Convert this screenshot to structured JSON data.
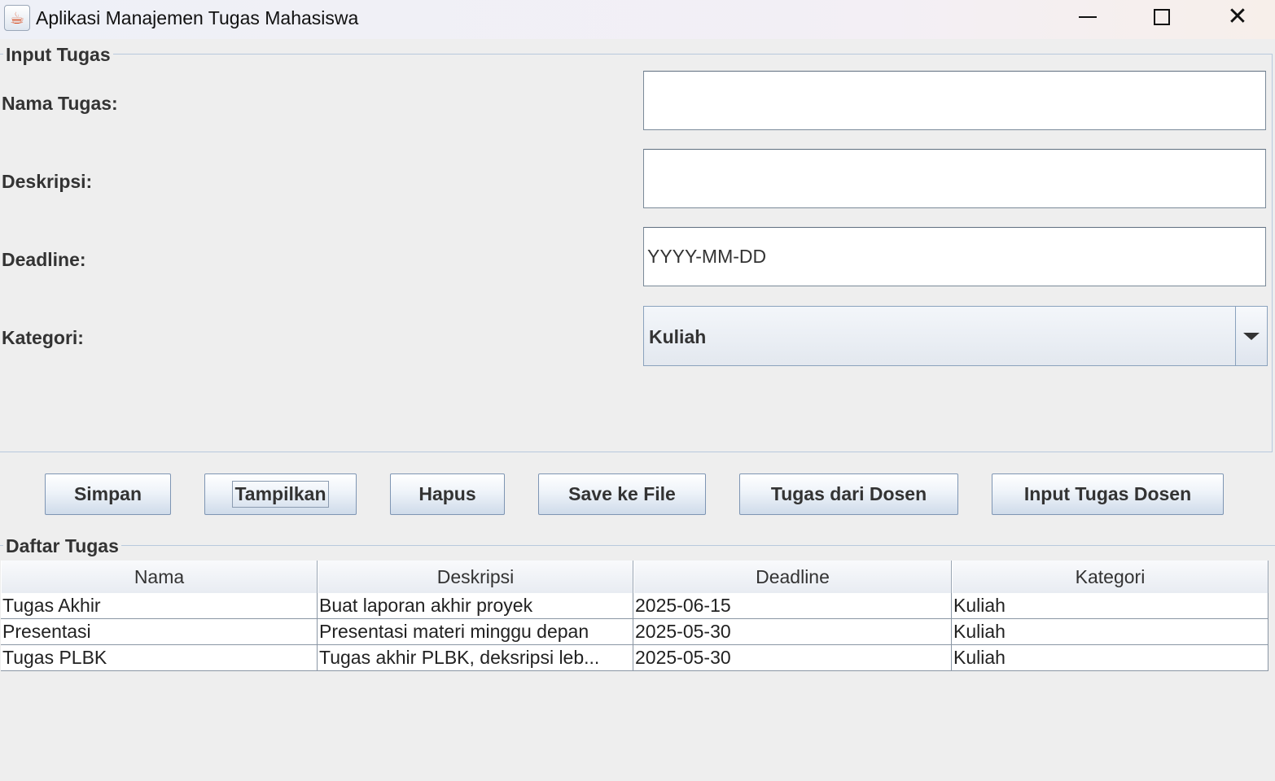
{
  "window": {
    "title": "Aplikasi Manajemen Tugas Mahasiswa",
    "app_icon": "java-icon"
  },
  "input_group": {
    "title": "Input Tugas",
    "nama_label": "Nama Tugas:",
    "nama_value": "",
    "deskripsi_label": "Deskripsi:",
    "deskripsi_value": "",
    "deadline_label": "Deadline:",
    "deadline_value": "YYYY-MM-DD",
    "kategori_label": "Kategori:",
    "kategori_selected": "Kuliah"
  },
  "buttons": {
    "simpan": "Simpan",
    "tampilkan": "Tampilkan",
    "hapus": "Hapus",
    "save_file": "Save ke File",
    "tugas_dosen": "Tugas dari Dosen",
    "input_dosen": "Input Tugas Dosen"
  },
  "list_group": {
    "title": "Daftar Tugas",
    "columns": [
      "Nama",
      "Deskripsi",
      "Deadline",
      "Kategori"
    ],
    "rows": [
      [
        "Tugas Akhir",
        "Buat laporan akhir proyek",
        "2025-06-15",
        "Kuliah"
      ],
      [
        "Presentasi",
        "Presentasi materi minggu depan",
        "2025-05-30",
        "Kuliah"
      ],
      [
        "Tugas PLBK",
        "Tugas akhir PLBK, deksripsi leb...",
        "2025-05-30",
        "Kuliah"
      ]
    ]
  }
}
